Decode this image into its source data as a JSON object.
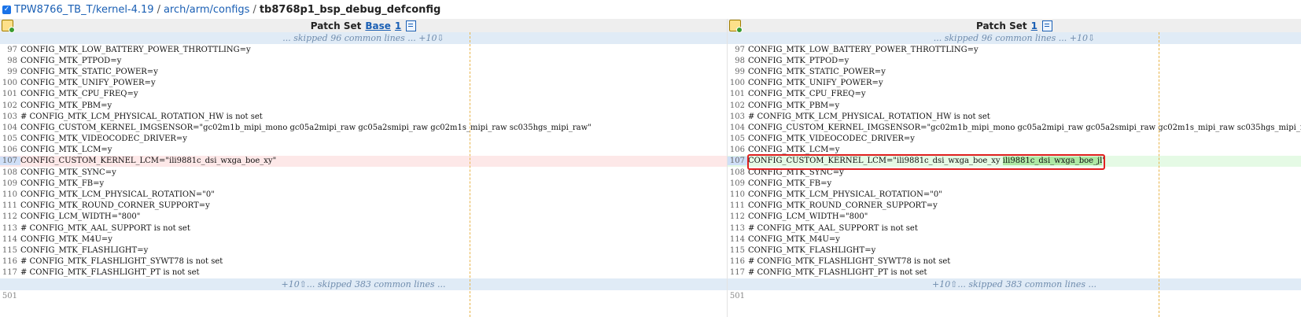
{
  "breadcrumb": {
    "project": "TPW8766_TB_T/kernel-4.19",
    "sep1": "/",
    "path": "arch/arm/configs",
    "sep2": "/",
    "file": "tb8768p1_bsp_debug_defconfig"
  },
  "left_pane": {
    "title": "Patch Set",
    "psname": "Base",
    "psnum": "1"
  },
  "right_pane": {
    "title": "Patch Set",
    "psnum": "1"
  },
  "skip_top": "... skipped 96 common lines ... +10⇩",
  "skip_bottom": "+10⇧... skipped 383 common lines ...",
  "lines": [
    {
      "n": "97",
      "text": "CONFIG_MTK_LOW_BATTERY_POWER_THROTTLING=y"
    },
    {
      "n": "98",
      "text": "CONFIG_MTK_PTPOD=y"
    },
    {
      "n": "99",
      "text": "CONFIG_MTK_STATIC_POWER=y"
    },
    {
      "n": "100",
      "text": "CONFIG_MTK_UNIFY_POWER=y"
    },
    {
      "n": "101",
      "text": "CONFIG_MTK_CPU_FREQ=y"
    },
    {
      "n": "102",
      "text": "CONFIG_MTK_PBM=y"
    },
    {
      "n": "103",
      "text": "# CONFIG_MTK_LCM_PHYSICAL_ROTATION_HW is not set"
    },
    {
      "n": "104",
      "text": "CONFIG_CUSTOM_KERNEL_IMGSENSOR=\"gc02m1b_mipi_mono gc05a2mipi_raw gc05a2smipi_raw gc02m1s_mipi_raw sc035hgs_mipi_raw\""
    },
    {
      "n": "105",
      "text": "CONFIG_MTK_VIDEOCODEC_DRIVER=y"
    },
    {
      "n": "106",
      "text": "CONFIG_MTK_LCM=y"
    },
    {
      "n": "107",
      "text": "CONFIG_CUSTOM_KERNEL_LCM=\"ili9881c_dsi_wxga_boe_xy\""
    },
    {
      "n": "108",
      "text": "CONFIG_MTK_SYNC=y"
    },
    {
      "n": "109",
      "text": "CONFIG_MTK_FB=y"
    },
    {
      "n": "110",
      "text": "CONFIG_MTK_LCM_PHYSICAL_ROTATION=\"0\""
    },
    {
      "n": "111",
      "text": "CONFIG_MTK_ROUND_CORNER_SUPPORT=y"
    },
    {
      "n": "112",
      "text": "CONFIG_LCM_WIDTH=\"800\""
    },
    {
      "n": "113",
      "text": "# CONFIG_MTK_AAL_SUPPORT is not set"
    },
    {
      "n": "114",
      "text": "CONFIG_MTK_M4U=y"
    },
    {
      "n": "115",
      "text": "CONFIG_MTK_FLASHLIGHT=y"
    },
    {
      "n": "116",
      "text": "# CONFIG_MTK_FLASHLIGHT_SYWT78 is not set"
    },
    {
      "n": "117",
      "text": "# CONFIG_MTK_FLASHLIGHT_PT is not set"
    }
  ],
  "changed_right": {
    "prefix": "CONFIG_CUSTOM_KERNEL_LCM=\"ili9881c_dsi_wxga_boe_xy ",
    "added": "ili9881c_dsi_wxga_boe_jl",
    "suffix": "\""
  },
  "bottom_line": "501"
}
